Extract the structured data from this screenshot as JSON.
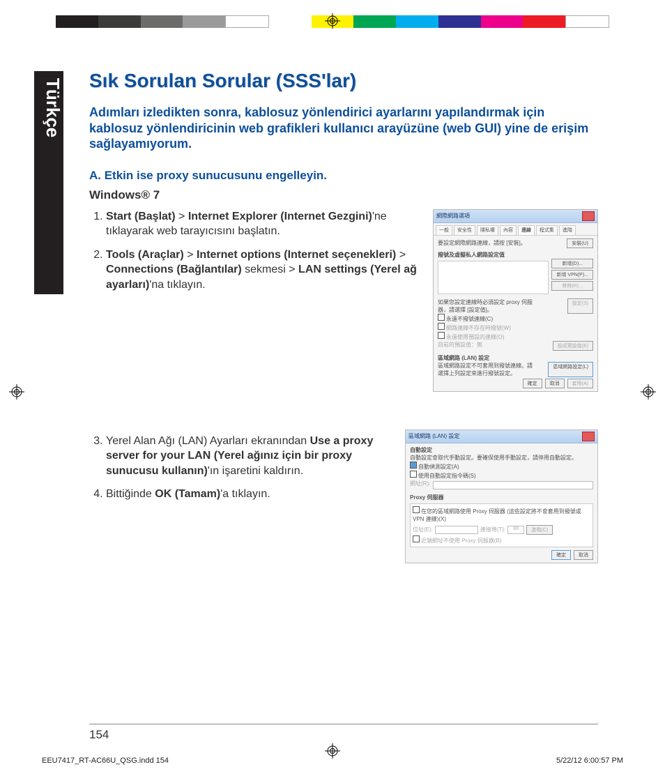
{
  "language_tab": "Türkçe",
  "title": "Sık Sorulan Sorular (SSS'lar)",
  "intro": "Adımları izledikten sonra, kablosuz yönlendirici ayarlarını yapılandırmak için kablosuz yönlendiricinin web grafikleri kullanıcı arayüzüne (web GUI) yine de erişim sağlayamıyorum.",
  "section_a": "A.  Etkin ise proxy sunucusunu engelleyin.",
  "os_label": "Windows® 7",
  "step1": {
    "pre": "",
    "b1": "Start (Başlat)",
    "mid1": " > ",
    "b2": "Internet Explorer (Internet Gezgini)",
    "post": "'ne tıklayarak web tarayıcısını başlatın."
  },
  "step2": {
    "b1": "Tools (Araçlar)",
    "mid1": " > ",
    "b2": "Internet options (Internet seçenekleri)",
    "mid2": " > ",
    "b3": "Connections (Bağlantılar)",
    "mid3": " sekmesi > ",
    "b4": "LAN settings (Yerel ağ ayarları)",
    "post": "'na tıklayın."
  },
  "step3": {
    "pre": "Yerel Alan Ağı (LAN) Ayarları ekranından ",
    "b1": "Use a proxy server for your LAN (Yerel ağınız için bir proxy sunucusu kullanın)",
    "post": "'ın işaretini kaldırın."
  },
  "step4": {
    "pre": "Bittiğinde ",
    "b1": "OK (Tamam)",
    "post": "'a tıklayın."
  },
  "shot1": {
    "title": "網際網路選項",
    "tabs": [
      "一般",
      "安全性",
      "隱私權",
      "內容",
      "連線",
      "程式集",
      "進階"
    ],
    "note1": "要設定網際網路連線，請按 [安裝]。",
    "btn_setup": "安裝(U)",
    "section_dial": "撥號及虛擬私人網路設定值",
    "btn_add": "新增(D)...",
    "btn_addvpn": "新增 VPN(P)...",
    "btn_remove": "移除(R)...",
    "note2": "如果您設定連線時必須設定 proxy 伺服器，請選擇 [設定值]。",
    "btn_settings": "設定(S)",
    "r1": "永遠不撥號連線(C)",
    "r2": "網路連線不存在時撥號(W)",
    "r3": "永遠使用預設的連線(O)",
    "default_line": "目前的預設值：無",
    "btn_default": "設成預設值(E)",
    "lan_header": "區域網路 (LAN) 設定",
    "lan_note": "區域網路設定不可套用到撥號連線。請選擇上列設定來進行撥號設定。",
    "btn_lan": "區域網路設定(L)",
    "ok": "確定",
    "cancel": "取消",
    "apply": "套用(A)"
  },
  "shot2": {
    "title": "區域網路 (LAN) 設定",
    "auto_header": "自動設定",
    "auto_note": "自動設定會取代手動設定。要確保使用手動設定，請停用自動設定。",
    "chk_auto": "自動偵測設定(A)",
    "chk_script": "使用自動設定指令碼(S)",
    "addr_label": "網址(R):",
    "proxy_header": "Proxy 伺服器",
    "chk_proxy": "在您的區域網路使用 Proxy 伺服器 (這些設定將不會套用到撥號或 VPN 連線)(X)",
    "addr2": "位址(E):",
    "port": "連接埠(T):",
    "port_val": "80",
    "btn_adv": "進階(C)",
    "chk_bypass": "近端網址不使用 Proxy 伺服器(B)",
    "ok": "確定",
    "cancel": "取消"
  },
  "page_number": "154",
  "footer_file": "EEU7417_RT-AC66U_QSG.indd   154",
  "footer_time": "5/22/12   6:00:57 PM"
}
